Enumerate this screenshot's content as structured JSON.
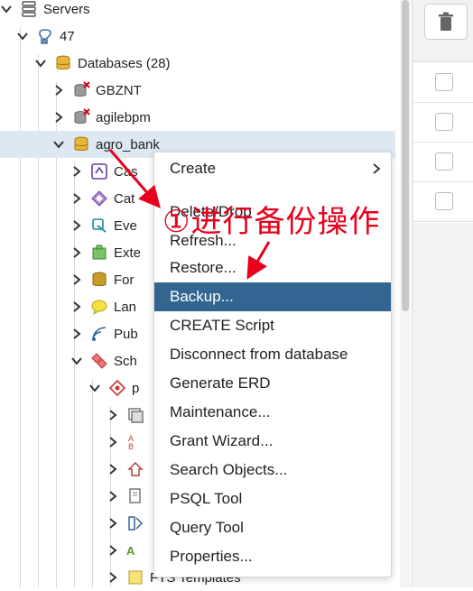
{
  "tree": {
    "rows": [
      {
        "label": "Servers",
        "icon": "server-group-icon"
      },
      {
        "label": "47",
        "icon": "postgres-elephant-icon"
      },
      {
        "label": "Databases (28)",
        "icon": "databases-icon"
      },
      {
        "label": "GBZNT",
        "icon": "database-disconnected-icon"
      },
      {
        "label": "agilebpm",
        "icon": "database-disconnected-icon"
      },
      {
        "label": "agro_bank",
        "icon": "database-icon"
      },
      {
        "label": "Cas",
        "icon": "casts-icon"
      },
      {
        "label": "Cat",
        "icon": "catalogs-icon"
      },
      {
        "label": "Eve",
        "icon": "event-triggers-icon"
      },
      {
        "label": "Exte",
        "icon": "extensions-icon"
      },
      {
        "label": "For",
        "icon": "foreign-data-wrappers-icon"
      },
      {
        "label": "Lan",
        "icon": "languages-icon"
      },
      {
        "label": "Pub",
        "icon": "publications-icon"
      },
      {
        "label": "Sch",
        "icon": "schemas-icon"
      },
      {
        "label": "p",
        "icon": "schema-icon"
      },
      {
        "label": "",
        "icon": "collations-icon"
      },
      {
        "label": "",
        "icon": "domains-icon"
      },
      {
        "label": "",
        "icon": "fts-configurations-icon"
      },
      {
        "label": "",
        "icon": "fts-dictionaries-icon"
      },
      {
        "label": "",
        "icon": "fts-parsers-icon"
      },
      {
        "label": "A",
        "icon": "fts-parser-text-icon"
      },
      {
        "label": "FTS Templates",
        "icon": "fts-templates-icon"
      }
    ]
  },
  "context_menu": {
    "items": [
      {
        "label": "Create",
        "has_submenu": true
      },
      {
        "label": "Delete/Drop"
      },
      {
        "label": "Refresh..."
      },
      {
        "label": "Restore..."
      },
      {
        "label": "Backup...",
        "highlighted": true
      },
      {
        "label": "CREATE Script"
      },
      {
        "label": "Disconnect from database"
      },
      {
        "label": "Generate ERD"
      },
      {
        "label": "Maintenance..."
      },
      {
        "label": "Grant Wizard..."
      },
      {
        "label": "Search Objects..."
      },
      {
        "label": "PSQL Tool"
      },
      {
        "label": "Query Tool"
      },
      {
        "label": "Properties..."
      }
    ]
  },
  "annotation": {
    "text": "①进行备份操作",
    "color": "#e8001c"
  },
  "colors": {
    "menu_highlight": "#326690",
    "selected_row": "#dde8f3",
    "db_gold": "#d9a21b",
    "disconnected_red": "#d0021b"
  }
}
